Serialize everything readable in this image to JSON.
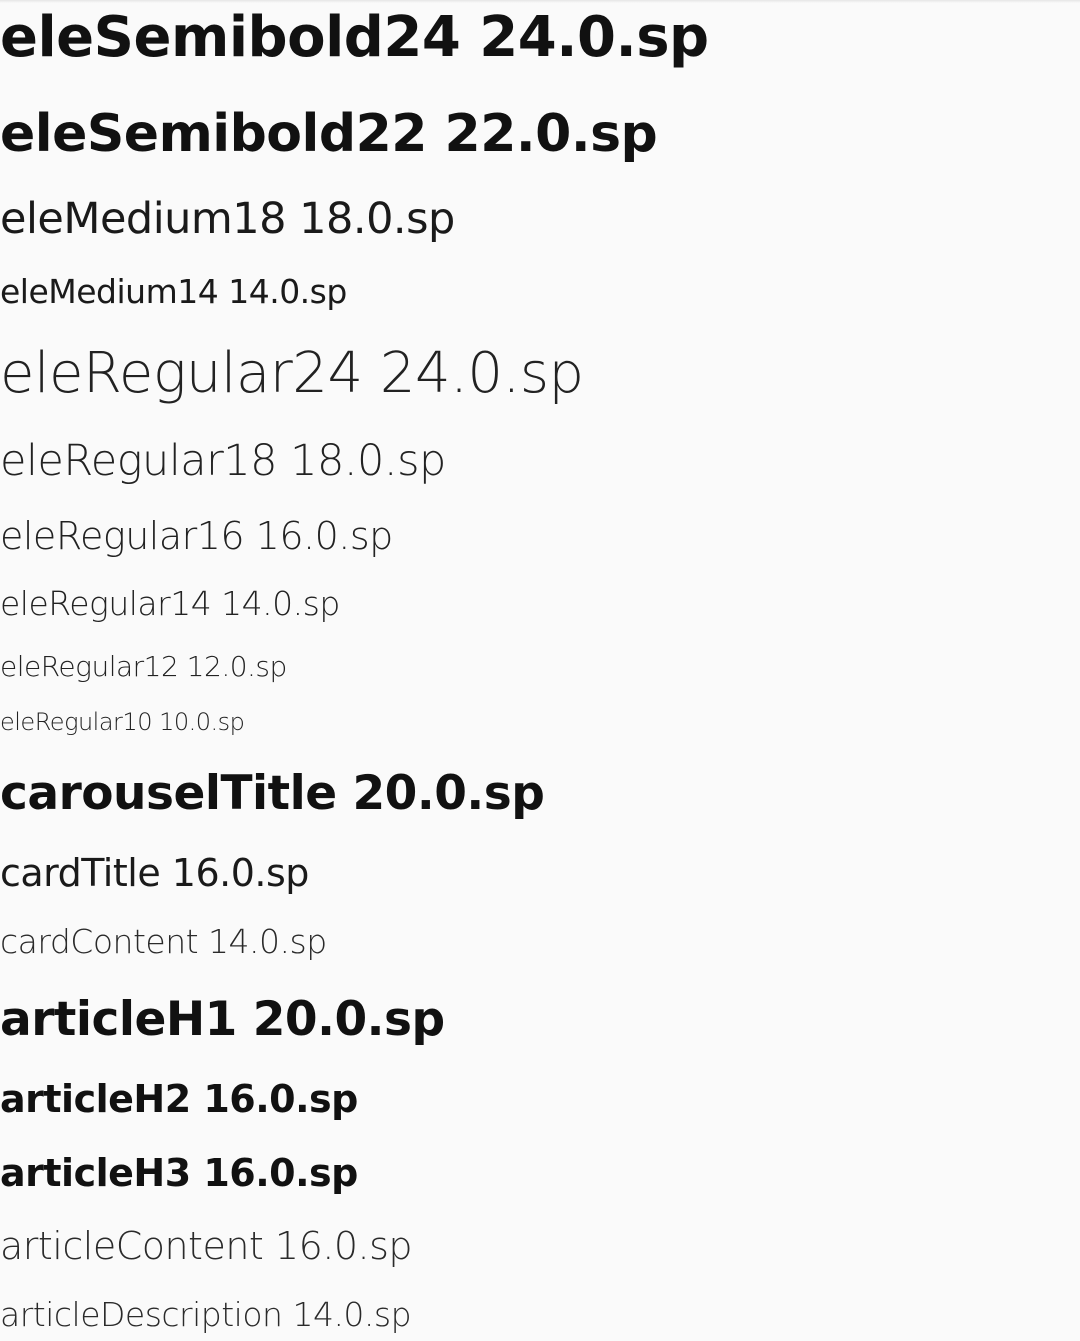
{
  "styles": [
    {
      "label": "eleSemibold24 24.0.sp"
    },
    {
      "label": "eleSemibold22 22.0.sp"
    },
    {
      "label": "eleMedium18 18.0.sp"
    },
    {
      "label": "eleMedium14 14.0.sp"
    },
    {
      "label": "eleRegular24 24.0.sp"
    },
    {
      "label": "eleRegular18 18.0.sp"
    },
    {
      "label": "eleRegular16 16.0.sp"
    },
    {
      "label": "eleRegular14 14.0.sp"
    },
    {
      "label": "eleRegular12 12.0.sp"
    },
    {
      "label": "eleRegular10 10.0.sp"
    },
    {
      "label": "carouselTitle 20.0.sp"
    },
    {
      "label": "cardTitle 16.0.sp"
    },
    {
      "label": "cardContent 14.0.sp"
    },
    {
      "label": "articleH1 20.0.sp"
    },
    {
      "label": "articleH2 16.0.sp"
    },
    {
      "label": "articleH3 16.0.sp"
    },
    {
      "label": "articleContent 16.0.sp"
    },
    {
      "label": "articleDescription 14.0.sp"
    }
  ],
  "colors": {
    "background": "#fafafa",
    "text": "#111111"
  }
}
